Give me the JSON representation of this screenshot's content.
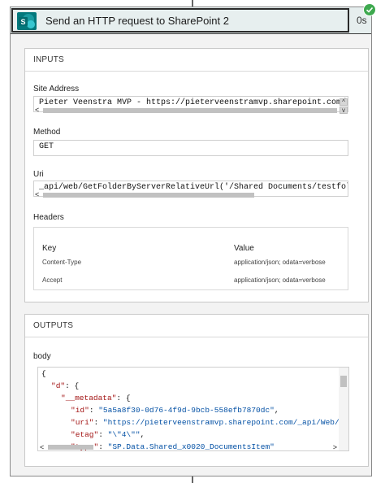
{
  "action": {
    "title": "Send an HTTP request to SharePoint 2",
    "duration": "0s",
    "status": "succeeded"
  },
  "inputs": {
    "section_label": "INPUTS",
    "site_address": {
      "label": "Site Address",
      "value": "Pieter Veenstra MVP - https://pieterveenstramvp.sharepoint.com/"
    },
    "method": {
      "label": "Method",
      "value": "GET"
    },
    "uri": {
      "label": "Uri",
      "value": "_api/web/GetFolderByServerRelativeUrl('/Shared Documents/testfolde"
    },
    "headers": {
      "label": "Headers",
      "columns": [
        "Key",
        "Value"
      ],
      "rows": [
        {
          "key": "Content-Type",
          "value": "application/json; odata=verbose"
        },
        {
          "key": "Accept",
          "value": "application/json; odata=verbose"
        }
      ]
    }
  },
  "outputs": {
    "section_label": "OUTPUTS",
    "body": {
      "label": "body",
      "lines": [
        {
          "indent": 0,
          "key": "",
          "text": "{"
        },
        {
          "indent": 1,
          "key": "\"d\"",
          "text": ": {"
        },
        {
          "indent": 2,
          "key": "\"__metadata\"",
          "text": ": {"
        },
        {
          "indent": 3,
          "key": "\"id\"",
          "text": ": ",
          "str": "\"5a5a8f30-0d76-4f9d-9bcb-558efb7870dc\"",
          "tail": ","
        },
        {
          "indent": 3,
          "key": "\"uri\"",
          "text": ": ",
          "str": "\"https://pieterveenstramvp.sharepoint.com/_api/Web/Lis",
          "tail": ""
        },
        {
          "indent": 3,
          "key": "\"etag\"",
          "text": ": ",
          "str": "\"\\\"4\\\"\"",
          "tail": ","
        },
        {
          "indent": 3,
          "key": "\"type\"",
          "text": ": ",
          "str": "\"SP.Data.Shared_x0020_DocumentsItem\"",
          "tail": ""
        }
      ]
    }
  },
  "colors": {
    "sharepoint_teal": "#03787c",
    "success_green": "#3ea94f",
    "json_key": "#a31515",
    "json_string": "#0451a5"
  },
  "icons": {
    "sharepoint": "sharepoint-icon",
    "success": "check-icon"
  }
}
